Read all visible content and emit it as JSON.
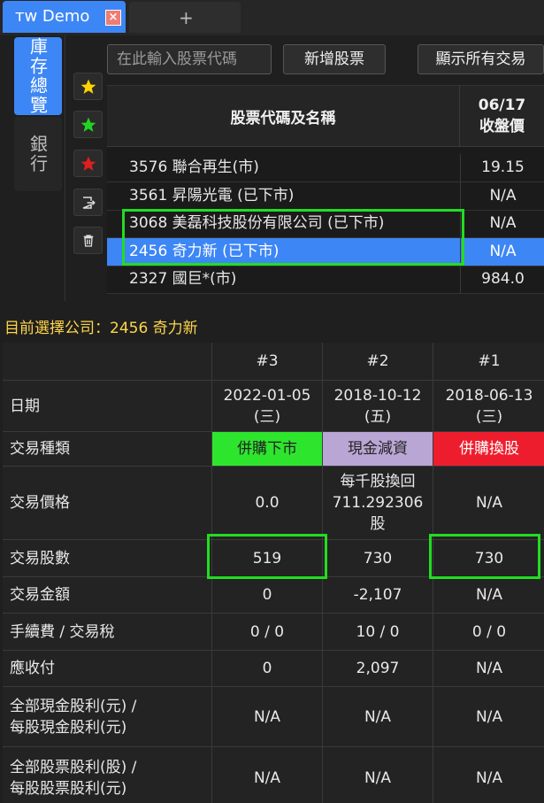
{
  "window": {
    "tab_title": "ᴛᴡ Demo",
    "close_glyph": "×",
    "new_tab_glyph": "+"
  },
  "left_tabs": [
    {
      "label": "庫存總覽",
      "active": true
    },
    {
      "label": "銀行",
      "active": false
    }
  ],
  "side_icons": [
    "star-yellow-icon",
    "star-green-icon",
    "star-red-icon",
    "export-icon",
    "trash-icon"
  ],
  "toolbar": {
    "search_placeholder": "在此輸入股票代碼",
    "add_button": "新增股票",
    "show_all_button": "顯示所有交易"
  },
  "stock_table": {
    "col_name": "股票代碼及名稱",
    "col_date": "06/17",
    "col_price": "收盤價",
    "rows": [
      {
        "name": "3576 聯合再生(市)",
        "price": "19.15",
        "selected": false
      },
      {
        "name": "3561 昇陽光電 (已下市)",
        "price": "N/A",
        "selected": false
      },
      {
        "name": "3068 美磊科技股份有限公司 (已下市)",
        "price": "N/A",
        "selected": false
      },
      {
        "name": "2456 奇力新 (已下市)",
        "price": "N/A",
        "selected": true
      },
      {
        "name": "2327 國巨*(市)",
        "price": "984.0",
        "selected": false
      }
    ]
  },
  "selection": {
    "label": "目前選擇公司：",
    "value": "2456 奇力新"
  },
  "transactions": {
    "columns": [
      "#3",
      "#2",
      "#1"
    ],
    "rows": {
      "date": {
        "label": "日期",
        "values": [
          [
            "2022-01-05",
            "(三)"
          ],
          [
            "2018-10-12",
            "(五)"
          ],
          [
            "2018-06-13",
            "(三)"
          ]
        ]
      },
      "type": {
        "label": "交易種類",
        "values": [
          "併購下市",
          "現金減資",
          "併購換股"
        ]
      },
      "price": {
        "label": "交易價格",
        "values": [
          "0.0",
          "每千股換回711.292306股",
          "N/A"
        ],
        "price_lines": [
          "每千股換回",
          "711.292306",
          "股"
        ]
      },
      "shares": {
        "label": "交易股數",
        "values": [
          "519",
          "730",
          "730"
        ]
      },
      "amount": {
        "label": "交易金額",
        "values": [
          "0",
          "-2,107",
          "N/A"
        ]
      },
      "fee": {
        "label": "手續費 / 交易稅",
        "values": [
          "0 / 0",
          "10 / 0",
          "0 / 0"
        ]
      },
      "receivable": {
        "label": "應收付",
        "values": [
          "0",
          "2,097",
          "N/A"
        ]
      },
      "cash_div": {
        "label1": "全部現金股利(元) /",
        "label2": "每股現金股利(元)",
        "values": [
          "N/A",
          "N/A",
          "N/A"
        ]
      },
      "stock_div": {
        "label1": "全部股票股利(股) /",
        "label2": "每股股票股利(元)",
        "values": [
          "N/A",
          "N/A",
          "N/A"
        ]
      }
    },
    "type_colors": [
      "#2ee52e",
      "#b9a6d4",
      "#ee1d2d"
    ]
  }
}
